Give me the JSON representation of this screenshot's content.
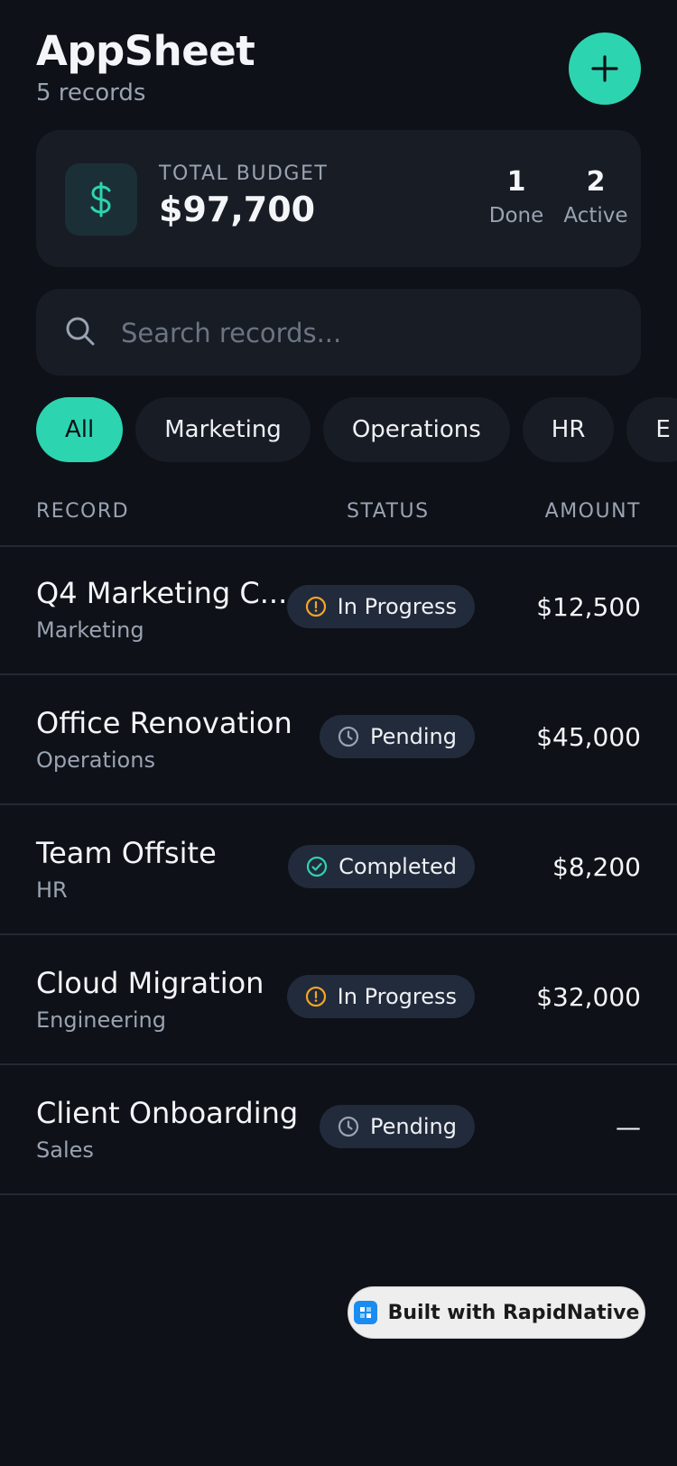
{
  "header": {
    "title": "AppSheet",
    "subtitle": "5 records",
    "add_icon": "plus-icon"
  },
  "summary": {
    "label": "TOTAL BUDGET",
    "value": "$97,700",
    "icon": "dollar-icon",
    "done_count": "1",
    "done_label": "Done",
    "active_count": "2",
    "active_label": "Active"
  },
  "search": {
    "placeholder": "Search records...",
    "value": ""
  },
  "filters": [
    "All",
    "Marketing",
    "Operations",
    "HR",
    "E"
  ],
  "columns": {
    "record": "RECORD",
    "status": "STATUS",
    "amount": "AMOUNT"
  },
  "records": [
    {
      "name": "Q4 Marketing C...",
      "category": "Marketing",
      "status": "In Progress",
      "status_icon": "alert-circle-icon",
      "amount": "$12,500"
    },
    {
      "name": "Office Renovation",
      "category": "Operations",
      "status": "Pending",
      "status_icon": "clock-icon",
      "amount": "$45,000"
    },
    {
      "name": "Team Offsite",
      "category": "HR",
      "status": "Completed",
      "status_icon": "check-circle-icon",
      "amount": "$8,200"
    },
    {
      "name": "Cloud Migration",
      "category": "Engineering",
      "status": "In Progress",
      "status_icon": "alert-circle-icon",
      "amount": "$32,000"
    },
    {
      "name": "Client Onboarding",
      "category": "Sales",
      "status": "Pending",
      "status_icon": "clock-icon",
      "amount": "—"
    }
  ],
  "colors": {
    "accent": "#2dd4b0",
    "warning": "#f5a524",
    "background": "#0e1117",
    "card": "#181c24"
  },
  "badge": {
    "label": "Built with RapidNative"
  }
}
